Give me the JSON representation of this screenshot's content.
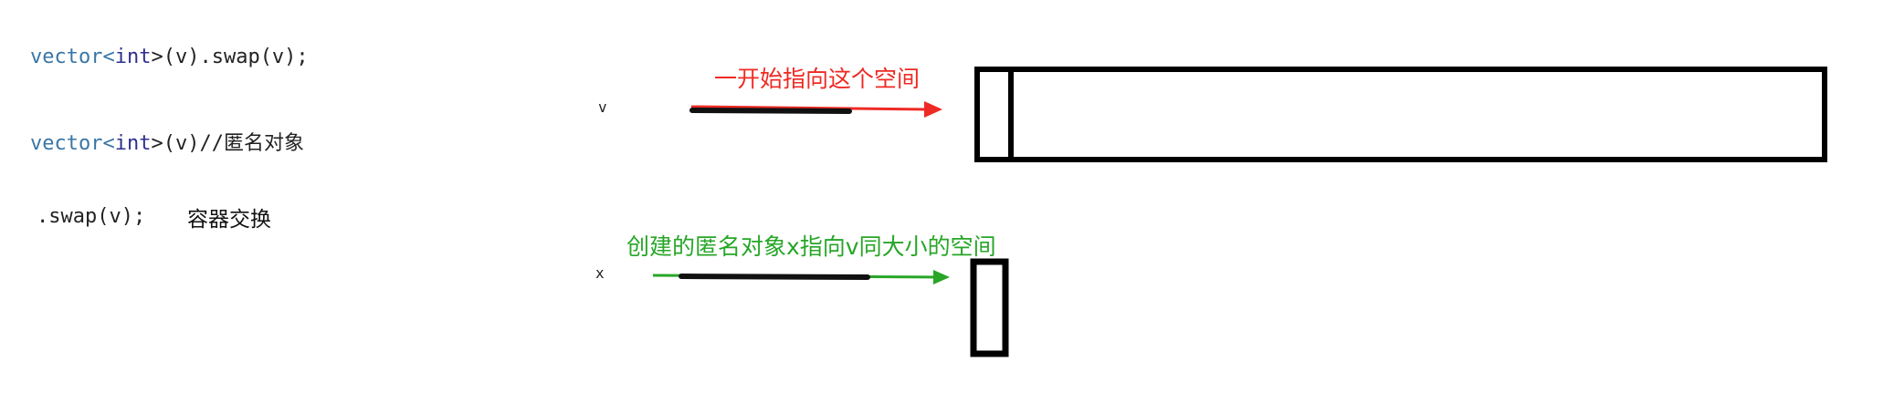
{
  "code": {
    "line1": {
      "type": "vector",
      "lt": "<",
      "int": "int",
      "rest": ">(v).swap(v);"
    },
    "line2": {
      "type": "vector",
      "lt": "<",
      "int": "int",
      "rest": ">(v)//匿名对象"
    },
    "line3": {
      "text": ".swap(v);",
      "note": "容器交换"
    }
  },
  "diagram": {
    "var_v": "v",
    "var_x": "x",
    "top_arrow_label": "一开始指向这个空间",
    "bottom_arrow_label": "创建的匿名对象x指向v同大小的空间",
    "colors": {
      "top_arrow": "#ee2a24",
      "bottom_arrow": "#27a627",
      "box_stroke": "#000000"
    }
  }
}
